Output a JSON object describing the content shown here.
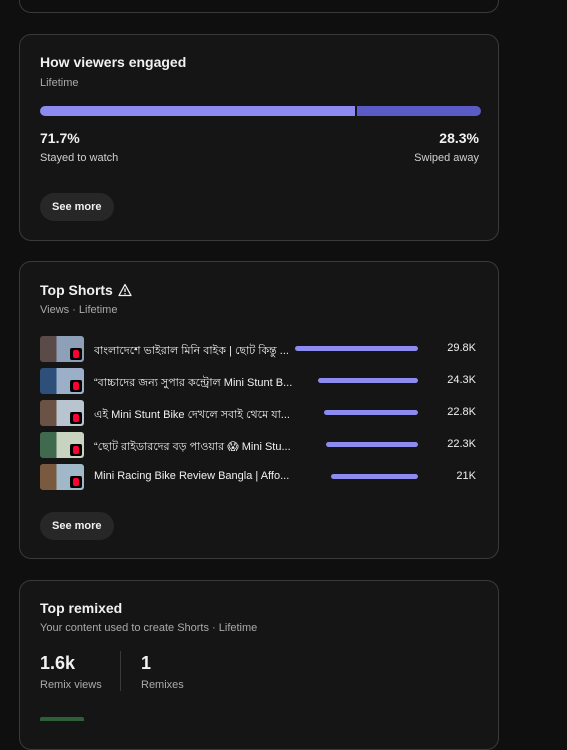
{
  "engagement": {
    "title": "How viewers engaged",
    "subtitle": "Lifetime",
    "stayed_pct": 71.7,
    "stayed_value": "71.7%",
    "stayed_label": "Stayed to watch",
    "swiped_value": "28.3%",
    "swiped_label": "Swiped away",
    "stayed_color": "#8b8bf0",
    "swiped_color": "#5b5bc8",
    "see_more": "See more"
  },
  "top_shorts": {
    "title": "Top Shorts",
    "subtitle": "Views · Lifetime",
    "warning_icon": "warning-triangle-icon",
    "bar_color": "#8b8bf0",
    "see_more": "See more",
    "items": [
      {
        "title": "বাংলাদেশে ভাইরাল মিনি বাইক | ছোট কিন্তু ...",
        "views": "29.8K",
        "views_num": 29800
      },
      {
        "title": "“বাচ্চাদের জন্য সুপার কন্ট্রোল Mini Stunt B...",
        "views": "24.3K",
        "views_num": 24300
      },
      {
        "title": "এই Mini Stunt Bike দেখলে সবাই থেমে যা...",
        "views": "22.8K",
        "views_num": 22800
      },
      {
        "title": "“ছোট রাইডারদের বড় পাওয়ার 😱 Mini Stu...",
        "views": "22.3K",
        "views_num": 22300
      },
      {
        "title": "Mini Racing Bike Review Bangla | Affo...",
        "views": "21K",
        "views_num": 21000
      }
    ]
  },
  "top_remixed": {
    "title": "Top remixed",
    "subtitle": "Your content used to create Shorts · Lifetime",
    "remix_views_value": "1.6k",
    "remix_views_label": "Remix views",
    "remixes_value": "1",
    "remixes_label": "Remixes"
  }
}
